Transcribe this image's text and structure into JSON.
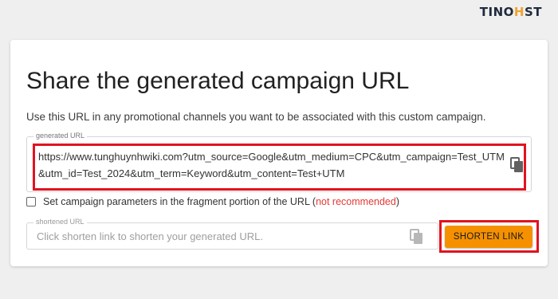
{
  "brand": {
    "text_left": "TINO",
    "text_gear": "H",
    "text_right": "ST",
    "accent_color": "#f0a32f"
  },
  "card": {
    "title": "Share the generated campaign URL",
    "subtitle": "Use this URL in any promotional channels you want to be associated with this custom campaign.",
    "generated_url": {
      "label": "generated URL",
      "value": "https://www.tunghuynhwiki.com?utm_source=Google&utm_medium=CPC&utm_campaign=Test_UTM&utm_id=Test_2024&utm_term=Keyword&utm_content=Test+UTM",
      "copy_icon": "copy-icon"
    },
    "fragment_option": {
      "label": "Set campaign parameters in the fragment portion of the URL (",
      "warning": "not recommended",
      "label_end": ")",
      "checked": false
    },
    "shortened_url": {
      "label": "shortened URL",
      "placeholder": "Click shorten link to shorten your generated URL.",
      "copy_icon": "copy-icon"
    },
    "shorten_button_label": "SHORTEN LINK"
  },
  "colors": {
    "button": "#f59100",
    "highlight": "#e0131f",
    "warning": "#e53935"
  }
}
